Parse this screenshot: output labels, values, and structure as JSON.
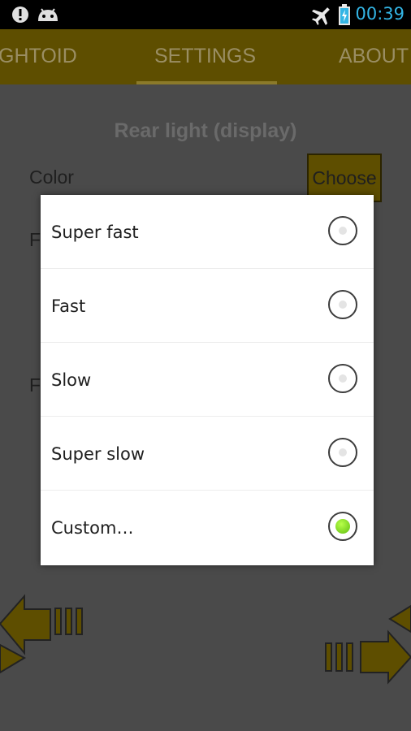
{
  "status_bar": {
    "time": "00:39",
    "icons": [
      "alert-icon",
      "android-icon",
      "airplane-icon",
      "battery-charging-icon"
    ]
  },
  "tabs": [
    "GHTOID",
    "SETTINGS",
    "ABOUT"
  ],
  "background": {
    "section_title": "Rear light (display)",
    "color_label": "Color",
    "choose_label": "Choose",
    "partial_label_1": "F",
    "partial_label_2": "F"
  },
  "dialog": {
    "options": [
      {
        "label": "Super fast",
        "selected": false
      },
      {
        "label": "Fast",
        "selected": false
      },
      {
        "label": "Slow",
        "selected": false
      },
      {
        "label": "Super slow",
        "selected": false
      },
      {
        "label": "Custom…",
        "selected": true
      }
    ]
  },
  "colors": {
    "accent_gold": "#c8a400",
    "status_time": "#33b5e5",
    "radio_selected": "#7bd61e"
  }
}
